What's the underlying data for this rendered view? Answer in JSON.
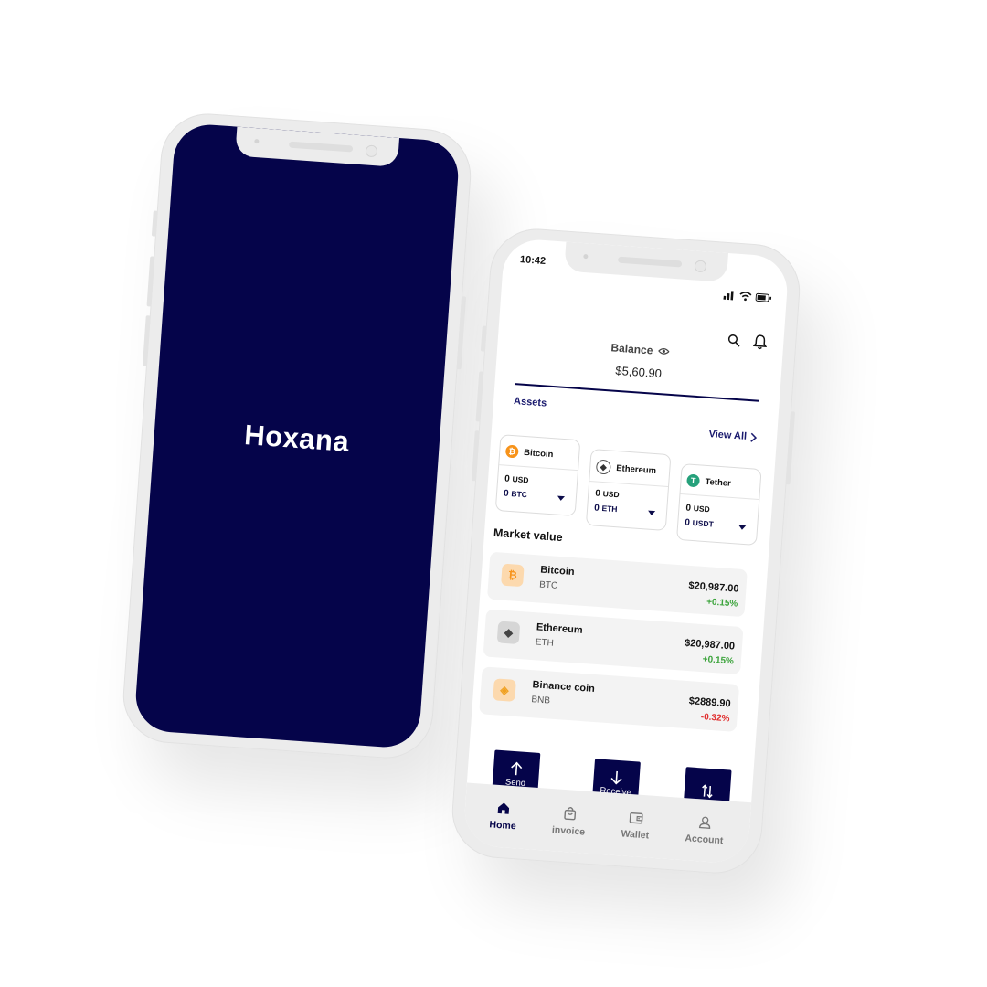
{
  "splash": {
    "title": "Hoxana",
    "background_color": "#05044a"
  },
  "status_bar": {
    "time": "10:42",
    "icons": [
      "signal-icon",
      "wifi-icon",
      "battery-icon"
    ]
  },
  "header": {
    "icons": [
      "search-icon",
      "bell-icon"
    ]
  },
  "balance": {
    "label": "Balance",
    "value": "$5,60.90",
    "icon": "eye-icon"
  },
  "assets": {
    "label": "Assets",
    "view_all": "View All",
    "items": [
      {
        "name": "Bitcoin",
        "usd_value": "0",
        "usd_unit": "USD",
        "coin_value": "0",
        "coin_unit": "BTC",
        "color": "#f7931a",
        "icon": "bitcoin-icon"
      },
      {
        "name": "Ethereum",
        "usd_value": "0",
        "usd_unit": "USD",
        "coin_value": "0",
        "coin_unit": "ETH",
        "color": "#627eea",
        "icon": "ethereum-icon"
      },
      {
        "name": "Tether",
        "usd_value": "0",
        "usd_unit": "USD",
        "coin_value": "0",
        "coin_unit": "USDT",
        "color": "#26a17b",
        "icon": "tether-icon"
      }
    ]
  },
  "market": {
    "label": "Market value",
    "items": [
      {
        "name": "Bitcoin",
        "symbol": "BTC",
        "price": "$20,987.00",
        "change": "+0.15%",
        "trend": "up",
        "icon": "bitcoin-icon"
      },
      {
        "name": "Ethereum",
        "symbol": "ETH",
        "price": "$20,987.00",
        "change": "+0.15%",
        "trend": "up",
        "icon": "ethereum-icon"
      },
      {
        "name": "Binance coin",
        "symbol": "BNB",
        "price": "$2889.90",
        "change": "-0.32%",
        "trend": "down",
        "icon": "binance-icon"
      }
    ]
  },
  "actions": {
    "send": "Send",
    "receive": "Receive",
    "swap_icon": "swap-icon"
  },
  "tabbar": {
    "items": [
      {
        "label": "Home",
        "icon": "home-icon",
        "active": true
      },
      {
        "label": "invoice",
        "icon": "shopping-bag-icon",
        "active": false
      },
      {
        "label": "Wallet",
        "icon": "wallet-icon",
        "active": false
      },
      {
        "label": "Account",
        "icon": "user-icon",
        "active": false
      }
    ]
  },
  "colors": {
    "brand": "#05044a",
    "positive": "#3aa33a",
    "negative": "#e03030"
  }
}
